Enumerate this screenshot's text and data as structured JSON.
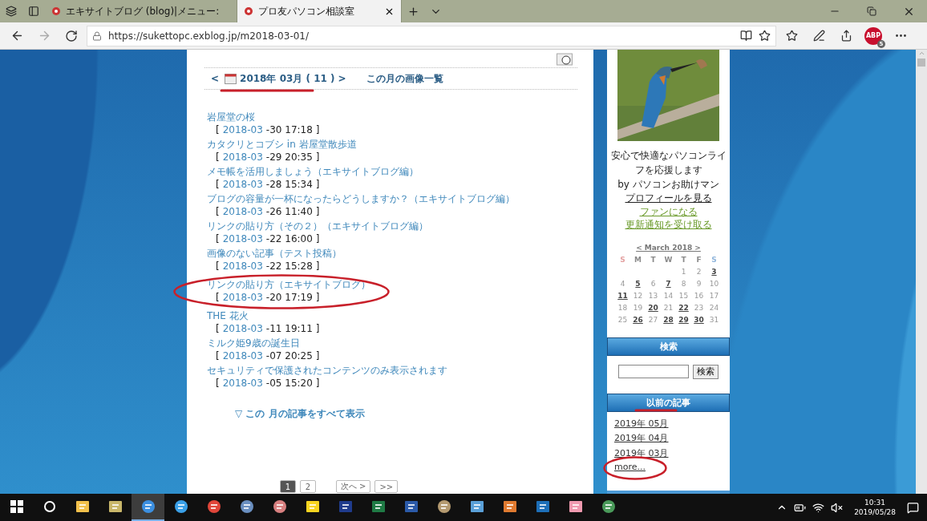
{
  "browser": {
    "tabs": [
      {
        "title": "エキサイトブログ (blog)|メニュー:",
        "selected": false
      },
      {
        "title": "プロ友パソコン相談室",
        "selected": true
      }
    ],
    "url": "https://sukettopc.exblog.jp/m2018-03-01/",
    "badge": {
      "label": "ABP",
      "count": "5"
    }
  },
  "month_nav": {
    "prev": "<",
    "month": "2018年 03月 ( 11 )",
    "underlined": true,
    "next": ">",
    "images_link": "この月の画像一覧"
  },
  "posts": [
    {
      "title": "岩屋堂の桜",
      "open": "[",
      "month": "2018-03",
      "time": "-30 17:18 ]",
      "circled": false
    },
    {
      "title": "カタクリとコブシ in 岩屋堂散歩道",
      "open": "[",
      "month": "2018-03",
      "time": "-29 20:35 ]",
      "circled": false
    },
    {
      "title": "メモ帳を活用しましょう（エキサイトブログ編）",
      "open": "[",
      "month": "2018-03",
      "time": "-28 15:34 ]",
      "circled": false
    },
    {
      "title": "ブログの容量が一杯になったらどうしますか？（エキサイトブログ編）",
      "open": "[",
      "month": "2018-03",
      "time": "-26 11:40 ]",
      "circled": false
    },
    {
      "title": "リンクの貼り方（その２）（エキサイトブログ編）",
      "open": "[",
      "month": "2018-03",
      "time": "-22 16:00 ]",
      "circled": false
    },
    {
      "title": "画像のない記事（テスト投稿）",
      "open": "[",
      "month": "2018-03",
      "time": "-22 15:28 ]",
      "circled": false
    },
    {
      "title": "リンクの貼り方（エキサイトブログ）",
      "open": "[",
      "month": "2018-03",
      "time": "-20 17:19 ]",
      "circled": true
    },
    {
      "title": "THE 花火",
      "open": "[",
      "month": "2018-03",
      "time": "-11 19:11 ]",
      "circled": false
    },
    {
      "title": "ミルク姫9歳の誕生日",
      "open": "[",
      "month": "2018-03",
      "time": "-07 20:25 ]",
      "circled": false
    },
    {
      "title": "セキュリティで保護されたコンテンツのみ表示されます",
      "open": "[",
      "month": "2018-03",
      "time": "-05 15:20 ]",
      "circled": false
    }
  ],
  "show_all": "▽ この 月の記事をすべて表示",
  "pagination": [
    {
      "label": "1",
      "selected": true
    },
    {
      "label": "2",
      "selected": false
    },
    {
      "label": "次へ >",
      "selected": false
    },
    {
      "label": ">>",
      "selected": false
    }
  ],
  "sidebar": {
    "tagline": "安心で快適なパソコンライフを応援します",
    "byline": "by パソコンお助けマン",
    "links": [
      {
        "label": "プロフィールを見る",
        "kind": "profile"
      },
      {
        "label": "ファンになる",
        "kind": "action"
      },
      {
        "label": "更新通知を受け取る",
        "kind": "action"
      }
    ],
    "calendar": {
      "title": "< March 2018 >",
      "weekdays": [
        {
          "label": "S",
          "color": "#e4a3a3"
        },
        {
          "label": "M",
          "color": "#8a8a8a"
        },
        {
          "label": "T",
          "color": "#8a8a8a"
        },
        {
          "label": "W",
          "color": "#8a8a8a"
        },
        {
          "label": "T",
          "color": "#8a8a8a"
        },
        {
          "label": "F",
          "color": "#8a8a8a"
        },
        {
          "label": "S",
          "color": "#93b7dc"
        }
      ],
      "weeks": [
        [
          {
            "day": "1",
            "linked": false
          },
          {
            "day": "2",
            "linked": false
          },
          {
            "day": "3",
            "linked": true
          }
        ],
        [
          {
            "day": "4",
            "linked": false
          },
          {
            "day": "5",
            "linked": true
          },
          {
            "day": "6",
            "linked": false
          },
          {
            "day": "7",
            "linked": true
          },
          {
            "day": "8",
            "linked": false
          },
          {
            "day": "9",
            "linked": false
          },
          {
            "day": "10",
            "linked": false
          }
        ],
        [
          {
            "day": "11",
            "linked": true
          },
          {
            "day": "12",
            "linked": false
          },
          {
            "day": "13",
            "linked": false
          },
          {
            "day": "14",
            "linked": false
          },
          {
            "day": "15",
            "linked": false
          },
          {
            "day": "16",
            "linked": false
          },
          {
            "day": "17",
            "linked": false
          }
        ],
        [
          {
            "day": "18",
            "linked": false
          },
          {
            "day": "19",
            "linked": false
          },
          {
            "day": "20",
            "linked": true
          },
          {
            "day": "21",
            "linked": false
          },
          {
            "day": "22",
            "linked": true
          },
          {
            "day": "23",
            "linked": false
          },
          {
            "day": "24",
            "linked": false
          }
        ],
        [
          {
            "day": "25",
            "linked": false
          },
          {
            "day": "26",
            "linked": true
          },
          {
            "day": "27",
            "linked": false
          },
          {
            "day": "28",
            "linked": true
          },
          {
            "day": "29",
            "linked": true
          },
          {
            "day": "30",
            "linked": true
          },
          {
            "day": "31",
            "linked": false
          }
        ]
      ]
    },
    "search": {
      "title": "検索",
      "button": "検索"
    },
    "archive": {
      "title": "以前の記事",
      "underlined": true,
      "links": [
        {
          "label": "2019年 05月",
          "circled": false
        },
        {
          "label": "2019年 04月",
          "circled": false
        },
        {
          "label": "2019年 03月",
          "circled": false
        },
        {
          "label": "more...",
          "circled": true
        }
      ]
    }
  },
  "taskbar": {
    "apps": [
      {
        "kind": "explorer",
        "active": false
      },
      {
        "kind": "notes",
        "active": false
      },
      {
        "kind": "edge",
        "active": true
      },
      {
        "kind": "ie",
        "active": false
      },
      {
        "kind": "chrome",
        "active": false
      },
      {
        "kind": "globe",
        "active": false
      },
      {
        "kind": "cutter",
        "active": false
      },
      {
        "kind": "sticky",
        "active": false
      },
      {
        "kind": "tile",
        "active": false
      },
      {
        "kind": "excel",
        "active": false
      },
      {
        "kind": "word",
        "active": false
      },
      {
        "kind": "paint",
        "active": false
      },
      {
        "kind": "monitor",
        "active": false
      },
      {
        "kind": "toolbox",
        "active": false
      },
      {
        "kind": "remote",
        "active": false
      },
      {
        "kind": "brush",
        "active": false
      },
      {
        "kind": "slack",
        "active": false
      }
    ],
    "time": "10:31",
    "date": "2019/05/28"
  }
}
